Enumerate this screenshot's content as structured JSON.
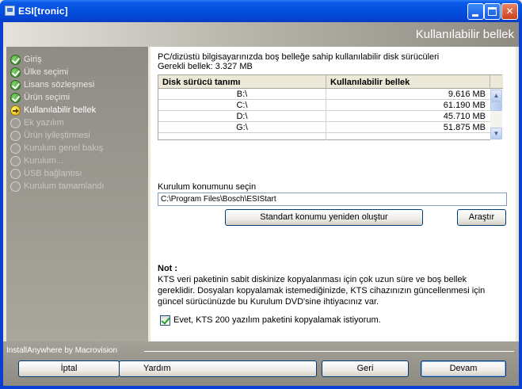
{
  "window": {
    "title": "ESI[tronic]",
    "header": "Kullanılabilir bellek"
  },
  "sidebar": {
    "steps": [
      {
        "label": "Giriş",
        "state": "done"
      },
      {
        "label": "Ülke seçimi",
        "state": "done"
      },
      {
        "label": "Lisans sözleşmesi",
        "state": "done"
      },
      {
        "label": "Ürün seçimi",
        "state": "done"
      },
      {
        "label": "Kullanılabilir bellek",
        "state": "current"
      },
      {
        "label": "Ek yazılım",
        "state": "pending"
      },
      {
        "label": "Ürün iyileştirmesi",
        "state": "pending"
      },
      {
        "label": "Kurulum genel bakış",
        "state": "pending"
      },
      {
        "label": "Kurulum...",
        "state": "pending"
      },
      {
        "label": "USB bağlantısı",
        "state": "pending"
      },
      {
        "label": "Kurulum tamamlandı",
        "state": "pending"
      }
    ]
  },
  "main": {
    "intro": "PC/dizüstü bilgisayarınızda boş belleğe sahip kullanılabilir disk sürücüleri",
    "required_memory": "Gerekli bellek: 3.327 MB",
    "table": {
      "columns": [
        "Disk sürücü tanımı",
        "Kullanılabilir bellek"
      ],
      "rows": [
        {
          "disk": "B:\\",
          "memory": "9.616  MB"
        },
        {
          "disk": "C:\\",
          "memory": "61.190  MB"
        },
        {
          "disk": "D:\\",
          "memory": "45.710  MB"
        },
        {
          "disk": "G:\\",
          "memory": "51.875  MB"
        }
      ]
    },
    "location_label": "Kurulum konumunu seçin",
    "location_value": "C:\\Program Files\\Bosch\\ESIStart",
    "recreate_button": "Standart konumu yeniden oluştur",
    "browse_button": "Araştır",
    "note_title": "Not :",
    "note_lines": [
      "KTS veri paketinin sabit diskinize kopyalanması için çok uzun süre ve boş bellek",
      "gereklidir. Dosyaları kopyalamak istemediğinizde, KTS cihazınızın güncellenmesi için",
      "güncel sürücünüzde bu Kurulum DVD'sine ihtiyacınız var."
    ],
    "checkbox_label": "Evet, KTS 200 yazılım paketini kopyalamak istiyorum.",
    "checkbox_checked": true
  },
  "footer": {
    "brand": "InstallAnywhere by Macrovision",
    "cancel": "İptal",
    "help": "Yardım",
    "back": "Geri",
    "next": "Devam"
  }
}
